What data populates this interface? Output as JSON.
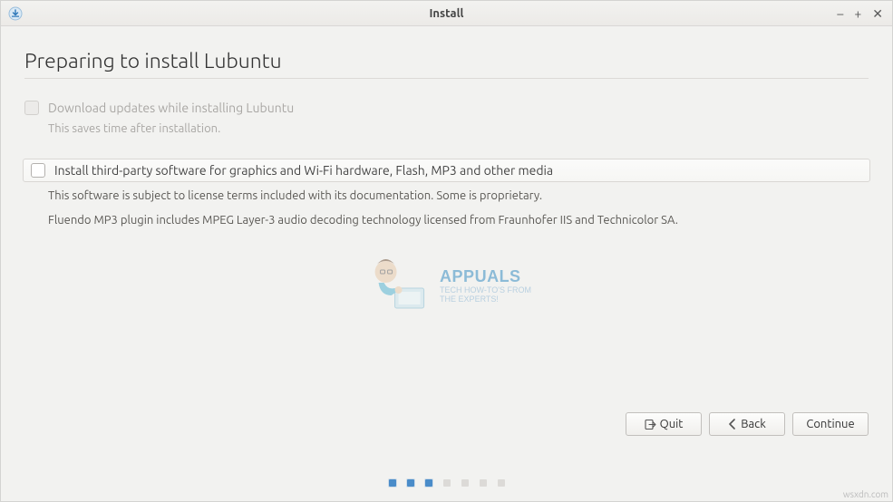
{
  "window": {
    "title": "Install"
  },
  "page": {
    "heading": "Preparing to install Lubuntu"
  },
  "options": {
    "updates": {
      "label": "Download updates while installing Lubuntu",
      "desc": "This saves time after installation.",
      "checked": false,
      "enabled": false
    },
    "thirdparty": {
      "label": "Install third-party software for graphics and Wi-Fi hardware, Flash, MP3 and other media",
      "desc1": "This software is subject to license terms included with its documentation. Some is proprietary.",
      "desc2": "Fluendo MP3 plugin includes MPEG Layer-3 audio decoding technology licensed from Fraunhofer IIS and Technicolor SA.",
      "checked": false,
      "enabled": true
    }
  },
  "buttons": {
    "quit": "Quit",
    "back": "Back",
    "continue": "Continue"
  },
  "progress": {
    "total": 7,
    "current": 3
  },
  "watermark": {
    "brand": "APPUALS",
    "line1": "TECH HOW-TO'S FROM",
    "line2": "THE EXPERTS!"
  },
  "source": "wsxdn.com"
}
